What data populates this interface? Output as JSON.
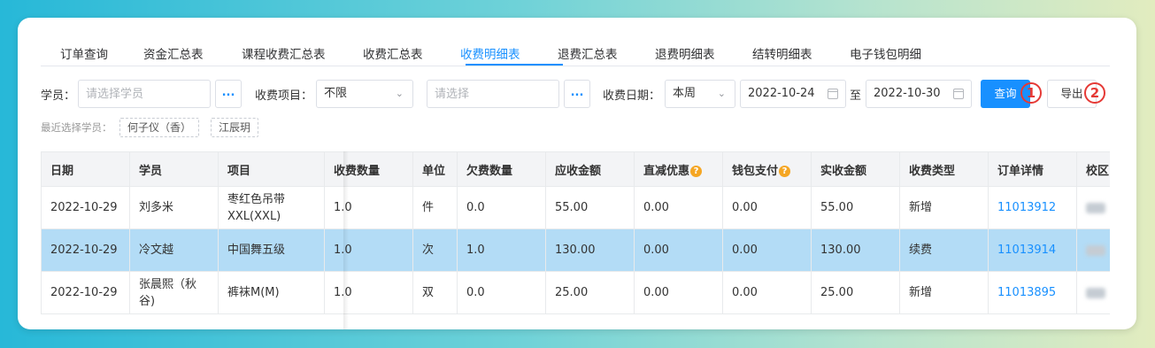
{
  "tabs": [
    {
      "label": "订单查询"
    },
    {
      "label": "资金汇总表"
    },
    {
      "label": "课程收费汇总表"
    },
    {
      "label": "收费汇总表"
    },
    {
      "label": "收费明细表"
    },
    {
      "label": "退费汇总表"
    },
    {
      "label": "退费明细表"
    },
    {
      "label": "结转明细表"
    },
    {
      "label": "电子钱包明细"
    }
  ],
  "active_tab": "收费明细表",
  "filters": {
    "student_label": "学员：",
    "student_placeholder": "请选择学员",
    "more_button": "...",
    "fee_item_label": "收费项目：",
    "fee_item_value": "不限",
    "select_placeholder": "请选择",
    "date_label": "收费日期：",
    "date_range_value": "本周",
    "date_start": "2022-10-24",
    "date_to": "至",
    "date_end": "2022-10-30",
    "query_button": "查询",
    "export_button": "导出",
    "marker_1": "1",
    "marker_2": "2"
  },
  "recent": {
    "label": "最近选择学员：",
    "students": [
      "何子仪（香）",
      "江辰玥"
    ]
  },
  "table": {
    "headers": [
      "日期",
      "学员",
      "项目",
      "收费数量",
      "单位",
      "欠费数量",
      "应收金额",
      "直减优惠",
      "钱包支付",
      "实收金额",
      "收费类型",
      "订单详情",
      "校区"
    ],
    "rows": [
      [
        "2022-10-29",
        "刘多米",
        "枣红色吊带XXL(XXL)",
        "1.0",
        "件",
        "0.0",
        "55.00",
        "0.00",
        "0.00",
        "55.00",
        "新增",
        "11013912"
      ],
      [
        "2022-10-29",
        "冷文越",
        "中国舞五级",
        "1.0",
        "次",
        "1.0",
        "130.00",
        "0.00",
        "0.00",
        "130.00",
        "续费",
        "11013914"
      ],
      [
        "2022-10-29",
        "张晨熙（秋谷)",
        "裤袜M(M)",
        "1.0",
        "双",
        "0.0",
        "25.00",
        "0.00",
        "0.00",
        "25.00",
        "新增",
        "11013895"
      ]
    ],
    "highlighted_row": 1
  },
  "colors": {
    "accent": "#1890ff",
    "highlight_row": "#b3dcf6",
    "marker": "#e53935",
    "help_icon": "#f5a623"
  }
}
